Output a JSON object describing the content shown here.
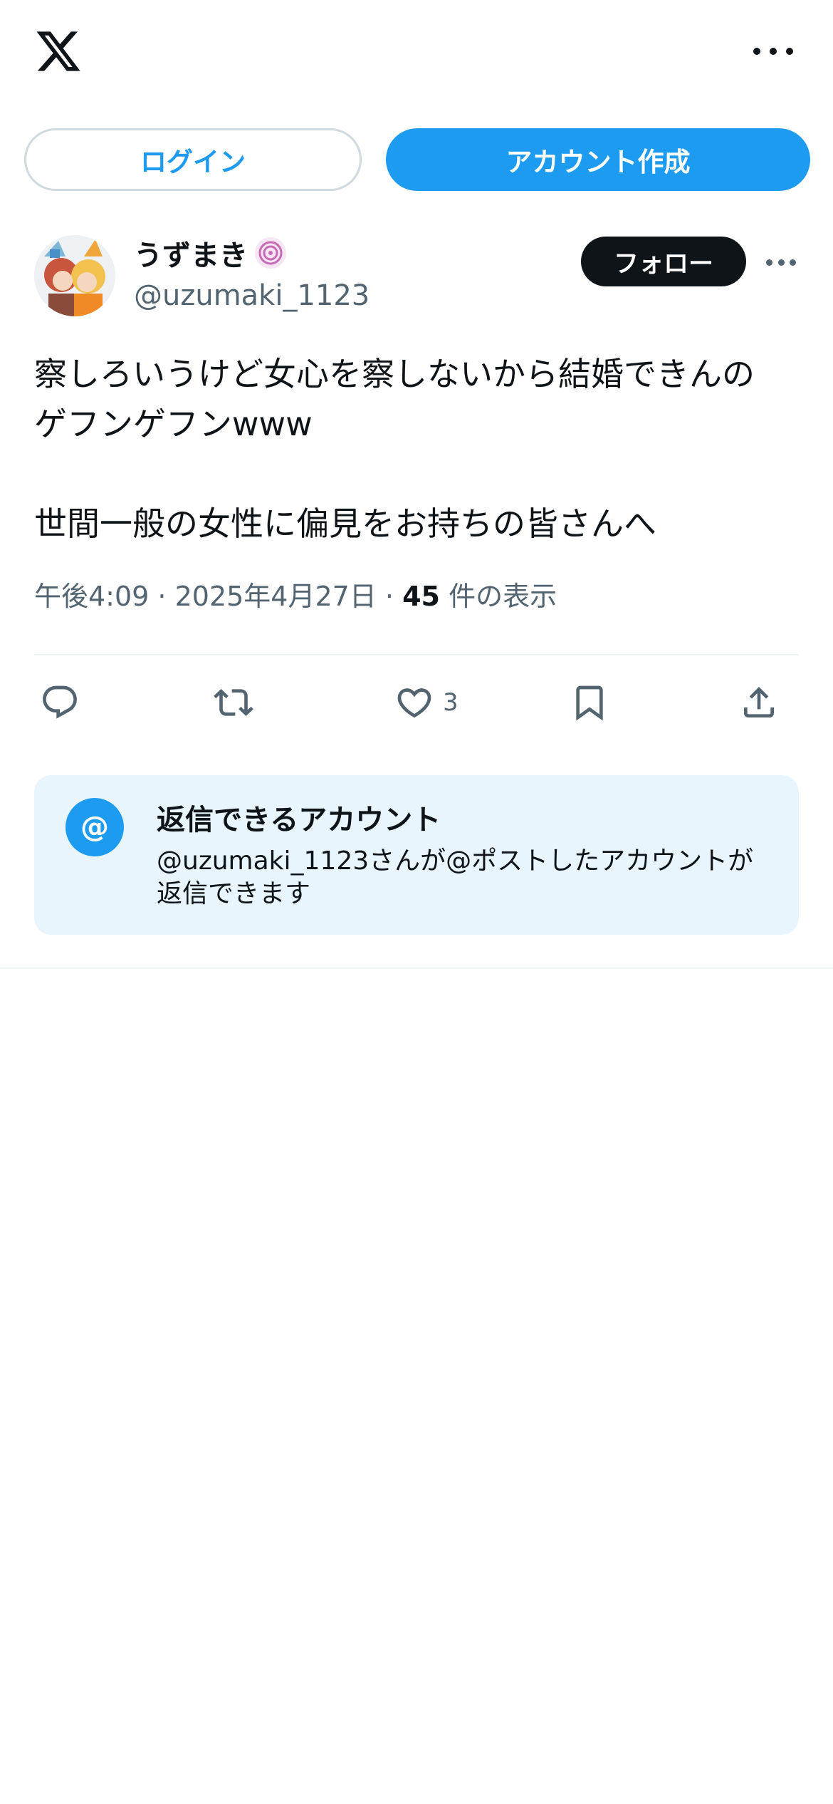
{
  "header": {
    "logo_icon": "x-logo-icon",
    "more_icon": "more-horizontal-icon"
  },
  "auth": {
    "login_label": "ログイン",
    "signup_label": "アカウント作成"
  },
  "post": {
    "author": {
      "display_name": "うずまき",
      "handle": "@uzumaki_1123",
      "badge_icon": "swirl-badge-icon"
    },
    "follow_label": "フォロー",
    "text_lines": [
      "察しろいうけど女心を察しないから結婚できんの",
      "ゲフンゲフンwww",
      "",
      "世間一般の女性に偏見をお持ちの皆さんへ"
    ],
    "meta": {
      "time": "午後4:09",
      "separator": " · ",
      "date": "2025年4月27日",
      "views_count": "45",
      "views_label": " 件の表示"
    },
    "actions": {
      "reply_icon": "reply-icon",
      "repost_icon": "repost-icon",
      "like_icon": "heart-icon",
      "like_count": "3",
      "bookmark_icon": "bookmark-icon",
      "share_icon": "share-icon"
    }
  },
  "reply_restriction": {
    "at_symbol": "@",
    "title": "返信できるアカウント",
    "description": "@uzumaki_1123さんが@ポストしたアカウントが返信できます"
  },
  "colors": {
    "accent": "#1d9bf0",
    "text_primary": "#0f1419",
    "text_secondary": "#536471",
    "card_bg": "#e8f5fd"
  }
}
